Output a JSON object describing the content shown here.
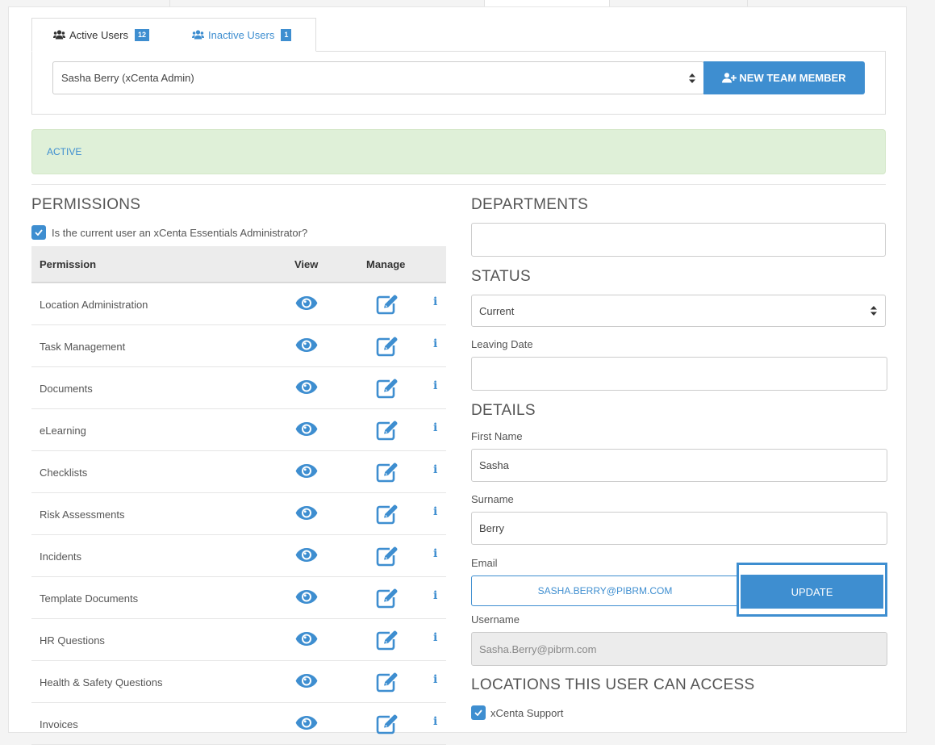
{
  "tabs": {
    "active_label": "Active Users",
    "active_count": "12",
    "inactive_label": "Inactive Users",
    "inactive_count": "1"
  },
  "user_select": {
    "selected": "Sasha Berry (xCenta Admin)"
  },
  "new_member_button": "NEW TEAM MEMBER",
  "status_alert": "ACTIVE",
  "permissions": {
    "title": "PERMISSIONS",
    "admin_question": "Is the current user an xCenta Essentials Administrator?",
    "admin_checked": true,
    "headers": {
      "permission": "Permission",
      "view": "View",
      "manage": "Manage"
    },
    "rows": [
      {
        "name": "Location Administration"
      },
      {
        "name": "Task Management"
      },
      {
        "name": "Documents"
      },
      {
        "name": "eLearning"
      },
      {
        "name": "Checklists"
      },
      {
        "name": "Risk Assessments"
      },
      {
        "name": "Incidents"
      },
      {
        "name": "Template Documents"
      },
      {
        "name": "HR Questions"
      },
      {
        "name": "Health & Safety Questions"
      },
      {
        "name": "Invoices"
      }
    ],
    "info_glyph": "i"
  },
  "departments": {
    "title": "DEPARTMENTS",
    "value": ""
  },
  "status": {
    "title": "STATUS",
    "selected": "Current",
    "leaving_date_label": "Leaving Date",
    "leaving_date_value": ""
  },
  "details": {
    "title": "DETAILS",
    "first_name_label": "First Name",
    "first_name": "Sasha",
    "surname_label": "Surname",
    "surname": "Berry",
    "email_label": "Email",
    "email": "SASHA.BERRY@PIBRM.COM",
    "update_button": "UPDATE",
    "username_label": "Username",
    "username": "Sasha.Berry@pibrm.com"
  },
  "locations": {
    "title": "LOCATIONS THIS USER CAN ACCESS",
    "items": [
      {
        "name": "xCenta Support",
        "checked": true
      }
    ]
  },
  "colors": {
    "accent": "#3e8ed0",
    "success_bg": "#dff0d8"
  },
  "icons": {
    "users": "users-icon",
    "user_plus": "user-plus-icon",
    "view": "eye-icon",
    "manage": "edit-icon",
    "info": "info-icon",
    "check": "check-icon",
    "sort": "sort-caret-icon"
  }
}
